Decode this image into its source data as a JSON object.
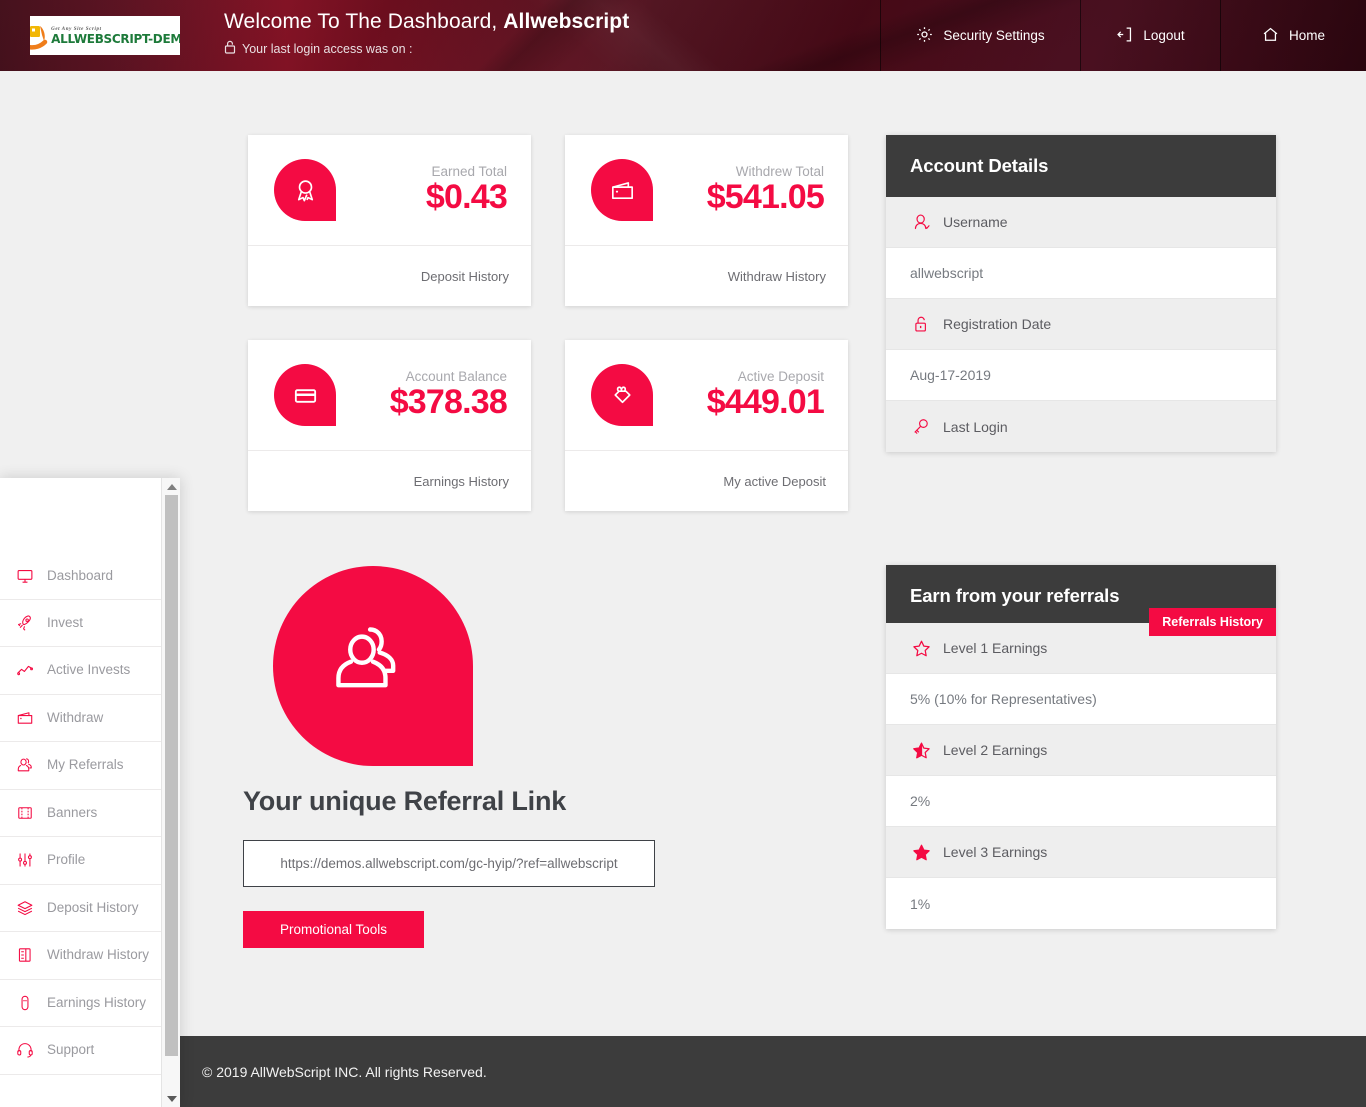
{
  "header": {
    "logo": {
      "tagline": "Get Any Site Script",
      "name": "ALLWEBSCRIPT-DEMO"
    },
    "welcome_prefix": "Welcome To The Dashboard, ",
    "welcome_user": "Allwebscript",
    "last_login_text": "Your last login access was on :",
    "nav": [
      {
        "label": "Security Settings",
        "icon": "gear-icon"
      },
      {
        "label": "Logout",
        "icon": "logout-icon"
      },
      {
        "label": "Home",
        "icon": "home-icon"
      }
    ]
  },
  "sidebar": {
    "items": [
      {
        "label": "Dashboard",
        "icon": "monitor-icon"
      },
      {
        "label": "Invest",
        "icon": "rocket-icon"
      },
      {
        "label": "Active Invests",
        "icon": "line-chart-icon"
      },
      {
        "label": "Withdraw",
        "icon": "wallet-icon"
      },
      {
        "label": "My Referrals",
        "icon": "user-group-icon"
      },
      {
        "label": "Banners",
        "icon": "film-icon"
      },
      {
        "label": "Profile",
        "icon": "sliders-icon"
      },
      {
        "label": "Deposit History",
        "icon": "layers-icon"
      },
      {
        "label": "Withdraw History",
        "icon": "notebook-icon"
      },
      {
        "label": "Earnings History",
        "icon": "capsule-icon"
      },
      {
        "label": "Support",
        "icon": "headset-icon"
      }
    ]
  },
  "cards": [
    {
      "label": "Earned Total",
      "value": "$0.43",
      "footer": "Deposit History",
      "icon": "award-ribbon-icon"
    },
    {
      "label": "Withdrew Total",
      "value": "$541.05",
      "footer": "Withdraw History",
      "icon": "wallet-icon"
    },
    {
      "label": "Account Balance",
      "value": "$378.38",
      "footer": "Earnings History",
      "icon": "credit-card-icon"
    },
    {
      "label": "Active Deposit",
      "value": "$449.01",
      "footer": "My active Deposit",
      "icon": "gift-tag-icon"
    }
  ],
  "account_details": {
    "title": "Account Details",
    "rows": [
      {
        "type": "label",
        "text": "Username",
        "icon": "user-check-icon"
      },
      {
        "type": "value",
        "text": "allwebscript"
      },
      {
        "type": "label",
        "text": "Registration Date",
        "icon": "unlock-icon"
      },
      {
        "type": "value",
        "text": "Aug-17-2019"
      },
      {
        "type": "label",
        "text": "Last Login",
        "icon": "key-icon"
      }
    ]
  },
  "referral_panel": {
    "title": "Earn from your referrals",
    "badge": "Referrals History",
    "rows": [
      {
        "type": "label",
        "text": "Level 1 Earnings",
        "icon": "star-outline-icon"
      },
      {
        "type": "value",
        "text": "5% (10% for Representatives)"
      },
      {
        "type": "label",
        "text": "Level 2 Earnings",
        "icon": "star-half-icon"
      },
      {
        "type": "value",
        "text": "2%"
      },
      {
        "type": "label",
        "text": "Level 3 Earnings",
        "icon": "star-filled-icon"
      },
      {
        "type": "value",
        "text": "1%"
      }
    ]
  },
  "referral_block": {
    "title": "Your unique Referral Link",
    "link_value": "https://demos.allwebscript.com/gc-hyip/?ref=allwebscript",
    "link_placeholder": "https://demos.allwebscript.com/gc-hyip/?ref=allwebscript",
    "button_label": "Promotional Tools",
    "avatar_icon": "user-group-icon"
  },
  "footer": {
    "text": "© 2019 AllWebScript INC. All rights Reserved."
  },
  "colors": {
    "accent": "#f40b43",
    "panel_head": "#3c3c3c",
    "page_bg": "#f0f0f0"
  }
}
